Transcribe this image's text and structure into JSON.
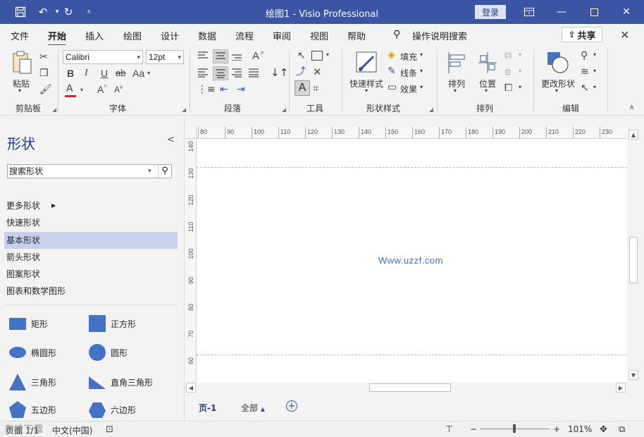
{
  "window": {
    "title": "绘图1 - Visio Professional",
    "login_label": "登录"
  },
  "colors": {
    "accent": "#3955a3",
    "shape_fill": "#4472c4",
    "selection": "#c7d1ee"
  },
  "menu": {
    "tabs": [
      "文件",
      "开始",
      "插入",
      "绘图",
      "设计",
      "数据",
      "流程",
      "审阅",
      "视图",
      "帮助"
    ],
    "active_tab": "开始",
    "search_label": "操作说明搜索",
    "share_label": "共享"
  },
  "ribbon": {
    "clipboard": {
      "paste": "粘贴",
      "label": "剪贴板"
    },
    "font": {
      "name": "Calibri",
      "size": "12pt",
      "bold": "B",
      "italic": "I",
      "underline": "U",
      "strike": "ab",
      "case": "Aa",
      "color": "A",
      "grow": "A",
      "shrink": "A",
      "label": "字体"
    },
    "paragraph": {
      "label": "段落"
    },
    "tools": {
      "text_tool": "A",
      "label": "工具"
    },
    "shape_styles": {
      "quick_styles": "快速样式",
      "fill": "填充",
      "line": "线条",
      "effects": "效果",
      "label": "形状样式"
    },
    "arrange": {
      "arrange": "排列",
      "position": "位置",
      "label": "排列"
    },
    "editing": {
      "change_shape": "更改形状",
      "label": "编辑"
    }
  },
  "shapes_pane": {
    "title": "形状",
    "search_value": "搜索形状",
    "categories": [
      "更多形状",
      "快速形状",
      "基本形状",
      "箭头形状",
      "图案形状",
      "图表和数学图形"
    ],
    "active_category": "基本形状",
    "shapes": [
      {
        "label": "矩形",
        "icon": "rectangle-icon"
      },
      {
        "label": "正方形",
        "icon": "square-icon"
      },
      {
        "label": "椭圆形",
        "icon": "ellipse-icon"
      },
      {
        "label": "圆形",
        "icon": "circle-icon"
      },
      {
        "label": "三角形",
        "icon": "triangle-icon"
      },
      {
        "label": "直角三角形",
        "icon": "right-triangle-icon"
      },
      {
        "label": "五边形",
        "icon": "pentagon-icon"
      },
      {
        "label": "六边形",
        "icon": "hexagon-icon"
      }
    ]
  },
  "rulers": {
    "top": [
      "80",
      "90",
      "100",
      "110",
      "120",
      "130",
      "140",
      "150",
      "160",
      "170",
      "180",
      "190",
      "200",
      "210",
      "220",
      "230"
    ],
    "left": [
      "140",
      "130",
      "120",
      "110",
      "100",
      "90",
      "80",
      "70",
      "60"
    ]
  },
  "canvas": {
    "watermark": "Www.uzzf.com"
  },
  "page_tabs": {
    "page1": "页-1",
    "all": "全部"
  },
  "status": {
    "page": "页面 1/1",
    "language": "中文(中国)",
    "zoom": "101%",
    "zoom_minus": "−",
    "zoom_plus": "+",
    "site_watermark": "东坡下载"
  }
}
